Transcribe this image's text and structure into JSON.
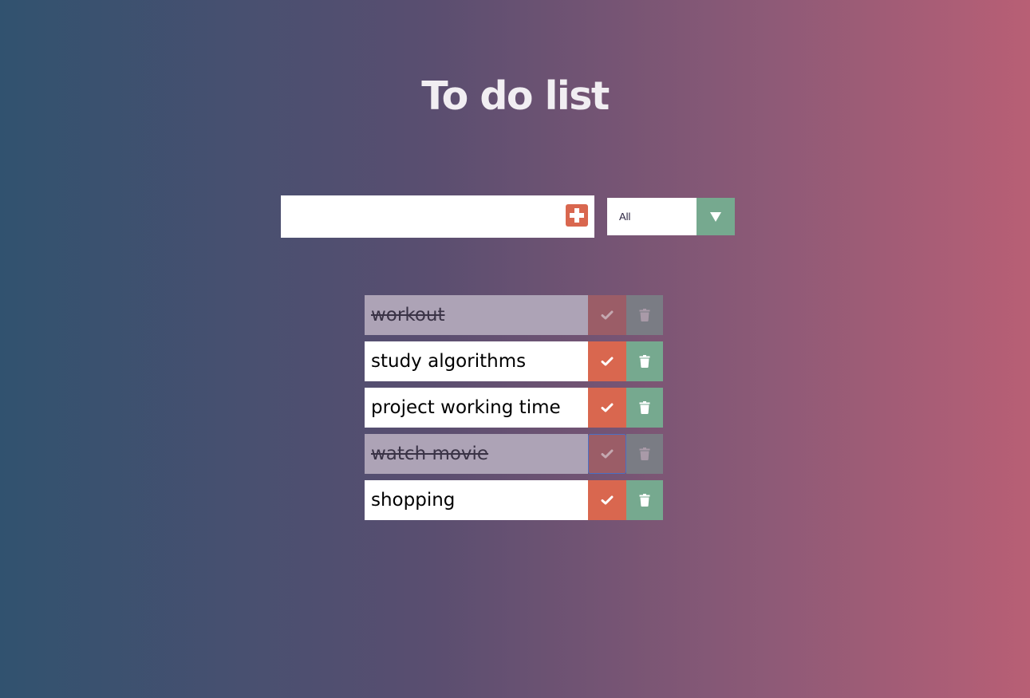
{
  "app": {
    "title": "To do list"
  },
  "form": {
    "input_value": "",
    "add_button_icon": "plus-square-icon",
    "filter_selected": "All",
    "filter_arrow_icon": "triangle-down-icon"
  },
  "todos": [
    {
      "text": "workout",
      "completed": true,
      "focused": false
    },
    {
      "text": "study algorithms",
      "completed": false,
      "focused": false
    },
    {
      "text": "project working time",
      "completed": false,
      "focused": false
    },
    {
      "text": "watch movie",
      "completed": true,
      "focused": true
    },
    {
      "text": "shopping",
      "completed": false,
      "focused": false
    }
  ],
  "item_icons": {
    "complete": "check-icon",
    "delete": "trash-icon"
  },
  "colors": {
    "gradient_left": "#31526f",
    "gradient_right": "#b85f75",
    "accent_orange": "#d9674f",
    "accent_green": "#76a98f",
    "completed_bg": "#ada3b6"
  }
}
